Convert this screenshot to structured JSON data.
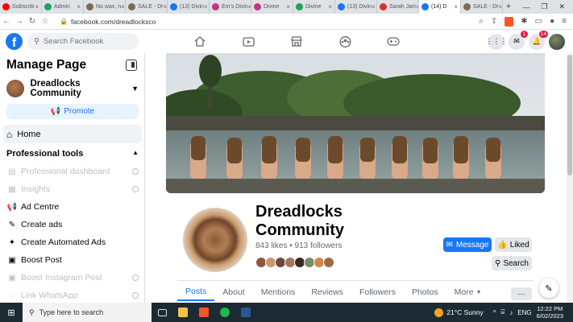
{
  "browser": {
    "tabs": [
      {
        "title": "Subscrib",
        "color": "#ff0000"
      },
      {
        "title": "Admin",
        "color": "#1aa260"
      },
      {
        "title": "No wax, n",
        "color": "#7a6a5a"
      },
      {
        "title": "SALE - Dr",
        "color": "#7a6a5a"
      },
      {
        "title": "(13) Divin",
        "color": "#1877f2"
      },
      {
        "title": "Em's Divin",
        "color": "#c13584"
      },
      {
        "title": "Divine",
        "color": "#c13584"
      },
      {
        "title": "Divine",
        "color": "#1aa260"
      },
      {
        "title": "(13) Divin",
        "color": "#1877f2"
      },
      {
        "title": "Sarah Jam",
        "color": "#d93025"
      },
      {
        "title": "(14) D",
        "color": "#1877f2"
      },
      {
        "title": "SALE - Dr",
        "color": "#7a6a5a"
      }
    ],
    "url": "facebook.com/dreadlocksco"
  },
  "fb": {
    "search_placeholder": "Search Facebook",
    "messenger_badge": "1",
    "notif_badge": "14"
  },
  "sidebar": {
    "title": "Manage Page",
    "page_name": "Dreadlocks Community",
    "promote": "Promote",
    "home": "Home",
    "professional_tools": "Professional tools",
    "items": [
      {
        "label": "Professional dashboard",
        "disabled": true
      },
      {
        "label": "Insights",
        "disabled": true
      },
      {
        "label": "Ad Centre",
        "disabled": false
      },
      {
        "label": "Create ads",
        "disabled": false
      },
      {
        "label": "Create Automated Ads",
        "disabled": false
      },
      {
        "label": "Boost Post",
        "disabled": false
      },
      {
        "label": "Boost Instagram Post",
        "disabled": true
      },
      {
        "label": "Link WhatsApp",
        "disabled": true
      }
    ]
  },
  "page": {
    "name": "Dreadlocks Community",
    "stats": "843 likes • 913 followers",
    "message": "Message",
    "liked": "Liked",
    "search": "Search",
    "tabs": [
      "Posts",
      "About",
      "Mentions",
      "Reviews",
      "Followers",
      "Photos",
      "More"
    ],
    "more_btn": "···"
  },
  "taskbar": {
    "search": "Type here to search",
    "weather": "21°C  Sunny",
    "lang": "ENG",
    "time": "12:22 PM",
    "date": "6/02/2023"
  }
}
